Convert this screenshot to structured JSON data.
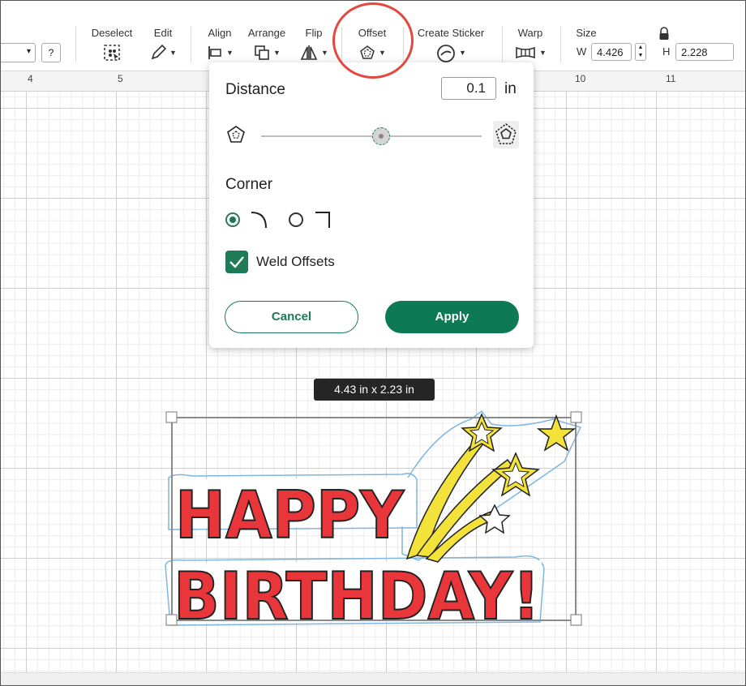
{
  "toolbar": {
    "font_select_caret": "▾",
    "help_label": "?",
    "deselect_label": "Deselect",
    "edit_label": "Edit",
    "align_label": "Align",
    "arrange_label": "Arrange",
    "flip_label": "Flip",
    "offset_label": "Offset",
    "create_sticker_label": "Create Sticker",
    "warp_label": "Warp",
    "size_label": "Size",
    "width_letter": "W",
    "width_value": "4.426",
    "height_letter": "H",
    "height_value": "2.228"
  },
  "ruler": {
    "numbers": [
      "4",
      "5",
      "10",
      "11"
    ]
  },
  "offset_popup": {
    "distance_label": "Distance",
    "distance_value": "0.1",
    "distance_unit": "in",
    "corner_label": "Corner",
    "corner_options": [
      "rounded",
      "square"
    ],
    "corner_selected": "rounded",
    "weld_label": "Weld Offsets",
    "weld_checked": true,
    "cancel_label": "Cancel",
    "apply_label": "Apply"
  },
  "selection": {
    "dimensions_label": "4.43  in x 2.23  in"
  },
  "design": {
    "line1": "HAPPY",
    "line2": "BIRTHDAY!"
  },
  "colors": {
    "accent": "#0e7a55",
    "highlight": "#e2483f",
    "letter_fill": "#e8363a",
    "star_fill": "#f3e23a",
    "offset_outline": "#7fb6e0"
  }
}
